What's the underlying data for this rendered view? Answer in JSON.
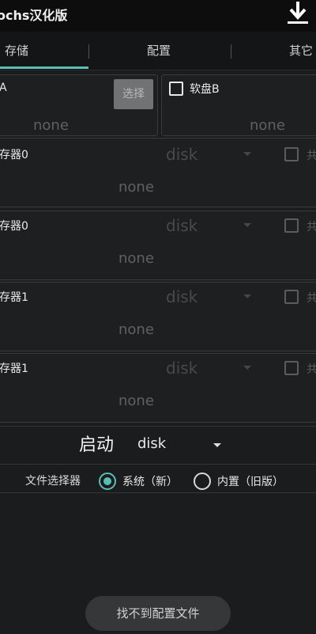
{
  "app": {
    "title": "ochs汉化版"
  },
  "icons": {
    "download": "download-icon"
  },
  "tabs": [
    {
      "label": "存储",
      "active": true
    },
    {
      "label": "配置",
      "active": false
    },
    {
      "label": "其它",
      "active": false
    }
  ],
  "floppy": {
    "a": {
      "label": "A",
      "choose_button": "选择",
      "value": "none"
    },
    "b": {
      "label": "软盘B",
      "value": "none"
    }
  },
  "drives": [
    {
      "label": "存器0",
      "type": "disk",
      "share": "共",
      "value": "none"
    },
    {
      "label": "存器0",
      "type": "disk",
      "share": "共",
      "value": "none"
    },
    {
      "label": "存器1",
      "type": "disk",
      "share": "共",
      "value": "none"
    },
    {
      "label": "存器1",
      "type": "disk",
      "share": "共",
      "value": "none"
    }
  ],
  "boot": {
    "label": "启动",
    "value": "disk"
  },
  "file_selector": {
    "label": "文件选择器",
    "options": [
      {
        "label": "系统（新）",
        "selected": true
      },
      {
        "label": "内置（旧版）",
        "selected": false
      }
    ]
  },
  "config_button": "找不到配置文件",
  "colors": {
    "accent": "#5bbdb5",
    "background": "#1b1c1d",
    "topbar": "#0d0d0d"
  }
}
